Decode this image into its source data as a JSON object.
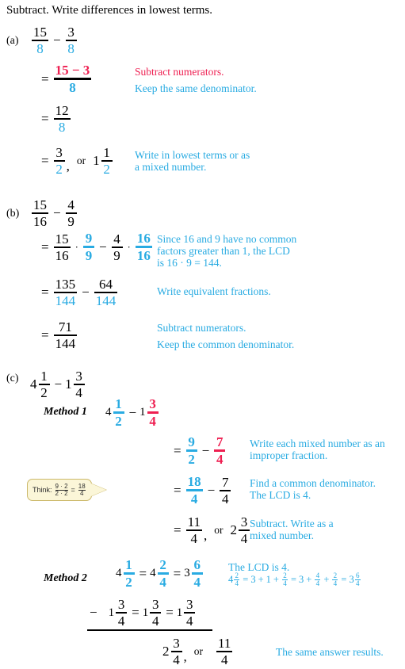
{
  "page": {
    "instruction": "Subtract. Write differences in lowest terms."
  },
  "colors": {
    "blue": "#29abe2",
    "red": "#ee1f51",
    "black": "#000000",
    "callout_fill": "#fbf6d8",
    "callout_border": "#cbb86a"
  },
  "parts": {
    "a": {
      "label": "(a)",
      "problem": {
        "left_num": "15",
        "left_den": "8",
        "operator": "−",
        "right_num": "3",
        "right_den": "8"
      },
      "steps": [
        {
          "eq_sign": "=",
          "num": "15 − 3",
          "den": "8",
          "annotations": [
            "Subtract numerators.",
            "Keep the same denominator."
          ]
        },
        {
          "eq_sign": "=",
          "num": "12",
          "den": "8",
          "annotations": []
        },
        {
          "eq_sign": "=",
          "num": "3",
          "den": "2",
          "comma": ",",
          "or_word": "or",
          "mixed_whole": "1",
          "mixed_num": "1",
          "mixed_den": "2",
          "annotations": [
            "Write in lowest terms or as",
            "a mixed number."
          ]
        }
      ]
    },
    "b": {
      "label": "(b)",
      "problem": {
        "left_num": "15",
        "left_den": "16",
        "operator": "−",
        "right_num": "4",
        "right_den": "9"
      },
      "steps": [
        {
          "eq_sign": "=",
          "f1_num": "15",
          "f1_den": "16",
          "dot1": "·",
          "f2_num": "9",
          "f2_den": "9",
          "operator": "−",
          "f3_num": "4",
          "f3_den": "9",
          "dot2": "·",
          "f4_num": "16",
          "f4_den": "16",
          "annotations": [
            "Since 16 and 9 have no common",
            "factors greater than 1, the LCD",
            "is 16 · 9 = 144."
          ]
        },
        {
          "eq_sign": "=",
          "f1_num": "135",
          "f1_den": "144",
          "operator": "−",
          "f2_num": "64",
          "f2_den": "144",
          "annotations": [
            "Write equivalent fractions."
          ]
        },
        {
          "eq_sign": "=",
          "f1_num": "71",
          "f1_den": "144",
          "annotations": [
            "Subtract numerators.",
            "Keep the common denominator."
          ]
        }
      ]
    },
    "c": {
      "label": "(c)",
      "problem": {
        "w1": "4",
        "n1": "1",
        "d1": "2",
        "operator": "−",
        "w2": "1",
        "n2": "3",
        "d2": "4"
      },
      "method1": {
        "title": "Method 1",
        "restate": {
          "w1": "4",
          "n1": "1",
          "d1": "2",
          "operator": "−",
          "w2": "1",
          "n2": "3",
          "d2": "4"
        },
        "think_callout": {
          "prefix": "Think:",
          "f1_num": "9 · 2",
          "f1_den": "2 · 2",
          "equals": "=",
          "f2_num": "18",
          "f2_den": "4"
        },
        "steps": [
          {
            "eq_sign": "=",
            "f1_num": "9",
            "f1_den": "2",
            "operator": "−",
            "f2_num": "7",
            "f2_den": "4",
            "annotations": [
              "Write each mixed number as an",
              "improper fraction."
            ]
          },
          {
            "eq_sign": "=",
            "f1_num": "18",
            "f1_den": "4",
            "operator": "−",
            "f2_num": "7",
            "f2_den": "4",
            "annotations": [
              "Find a common denominator.",
              "The LCD is 4."
            ]
          },
          {
            "eq_sign": "=",
            "f1_num": "11",
            "f1_den": "4",
            "comma": ",",
            "or_word": "or",
            "mixed_whole": "2",
            "mixed_num": "3",
            "mixed_den": "4",
            "annotations": [
              "Subtract. Write as a",
              "mixed number."
            ]
          }
        ]
      },
      "method2": {
        "title": "Method 2",
        "minuend": {
          "w1": "4",
          "n1": "1",
          "d1": "2",
          "eq1": "=",
          "w2": "4",
          "n2": "2",
          "d2": "4",
          "eq2": "=",
          "w3": "3",
          "n3": "6",
          "d3": "4"
        },
        "subtrahend": {
          "minus": "−",
          "w1": "1",
          "n1": "3",
          "d1": "4",
          "eq1": "=",
          "w2": "1",
          "n2": "3",
          "d2": "4",
          "eq2": "=",
          "w3": "1",
          "n3": "3",
          "d3": "4"
        },
        "result": {
          "whole": "2",
          "num": "3",
          "den": "4",
          "comma": ",",
          "or_word": "or",
          "improper_num": "11",
          "improper_den": "4",
          "note": "The same answer results."
        },
        "annotation_line1": "The LCD is 4.",
        "annotation_line2_parts": {
          "a_w": "4",
          "a_n": "2",
          "a_d": "4",
          "eq1": "=",
          "t3": "3",
          "plus1": "+",
          "t1": "1",
          "plus2": "+",
          "b_n": "2",
          "b_d": "4",
          "eq2": "=",
          "t3b": "3",
          "plus3": "+",
          "c_n": "4",
          "c_d": "4",
          "plus4": "+",
          "d_n": "2",
          "d_d": "4",
          "eq3": "=",
          "e_w": "3",
          "e_n": "6",
          "e_d": "4"
        }
      }
    }
  }
}
